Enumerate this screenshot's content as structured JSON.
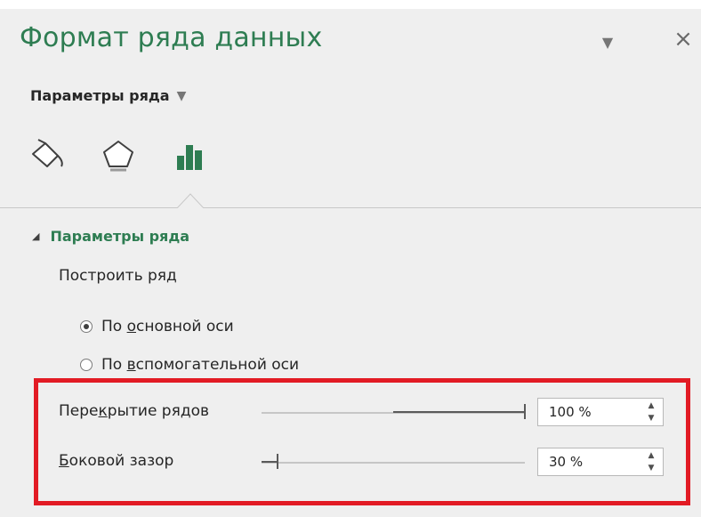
{
  "pane": {
    "title": "Формат ряда данных",
    "dropdown_icon": "triangle-down-icon",
    "close_icon": "close-icon",
    "close_symbol": "×",
    "dropdown_symbol": "▼"
  },
  "section_menu": {
    "label": "Параметры ряда",
    "arrow": "▼"
  },
  "tabs": [
    {
      "name": "fill-and-line",
      "icon": "paint-bucket-icon",
      "active": false
    },
    {
      "name": "effects",
      "icon": "pentagon-icon",
      "active": false
    },
    {
      "name": "series-options",
      "icon": "bar-chart-icon",
      "active": true
    }
  ],
  "group": {
    "collapse_symbol": "◢",
    "label": "Параметры ряда",
    "plot_series_label": "Построить ряд",
    "radio_primary": {
      "before": "По ",
      "underlined": "о",
      "after": "сновной оси",
      "checked": true
    },
    "radio_secondary": {
      "before": "По ",
      "underlined": "в",
      "after": "спомогательной оси",
      "checked": false
    },
    "overlap": {
      "before": "Пере",
      "underlined": "к",
      "after": "рытие рядов",
      "value": "100 %",
      "level": 1.0
    },
    "gap": {
      "before": "",
      "underlined": "Б",
      "after": "оковой зазор",
      "value": "30 %",
      "level": 0.06
    }
  },
  "colors": {
    "accent_green": "#2e7d52",
    "highlight_red": "#e21b24",
    "panel_bg": "#efefef"
  }
}
